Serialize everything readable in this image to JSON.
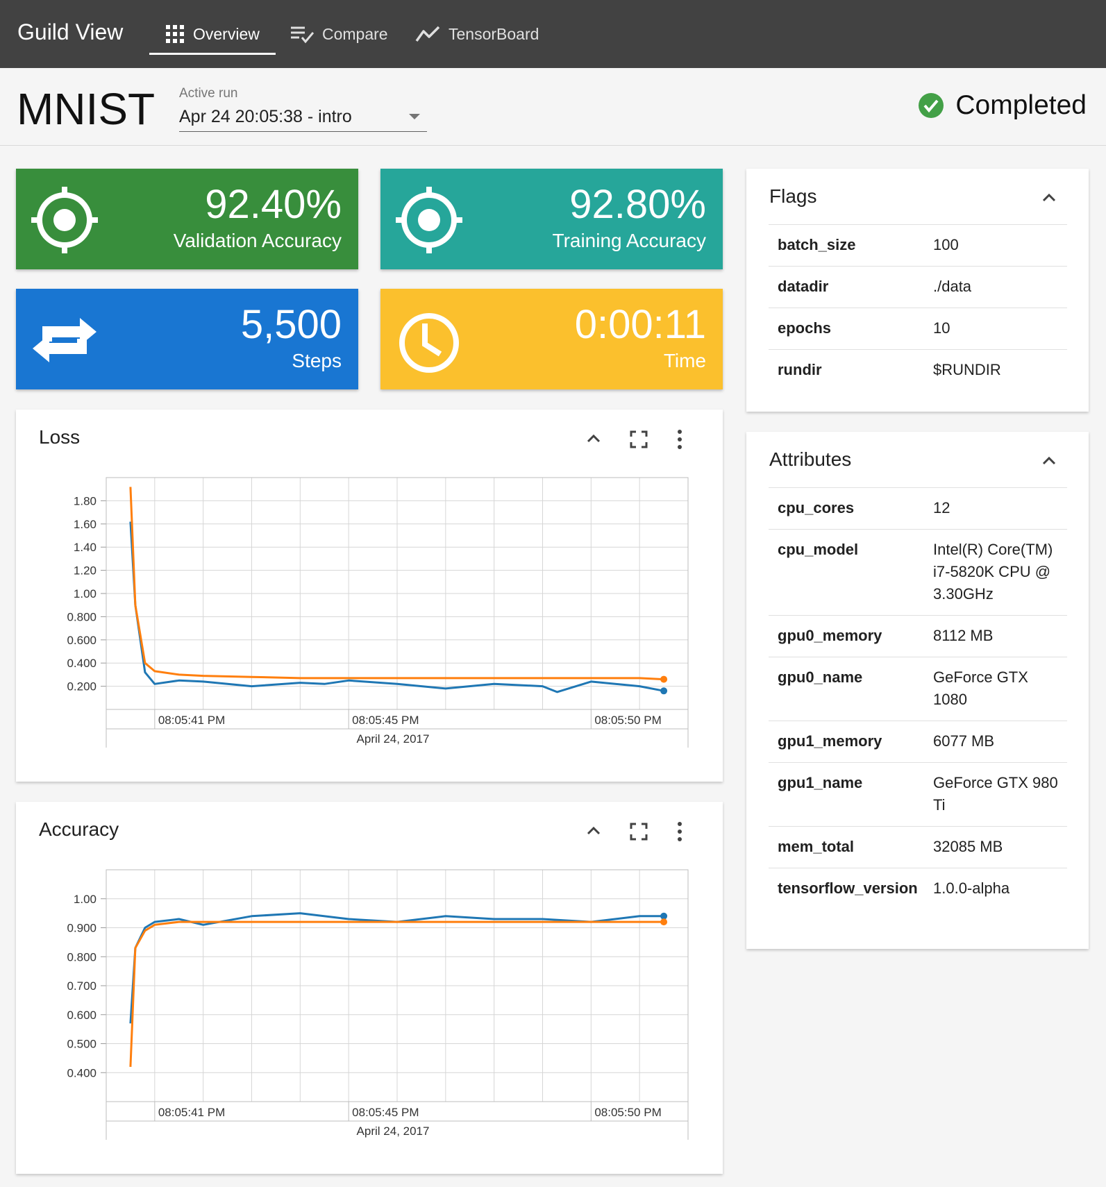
{
  "nav": {
    "brand": "Guild View",
    "tabs": [
      {
        "label": "Overview",
        "icon": "grid-icon",
        "active": true
      },
      {
        "label": "Compare",
        "icon": "compare-list-icon"
      },
      {
        "label": "TensorBoard",
        "icon": "line-chart-icon"
      }
    ]
  },
  "header": {
    "project": "MNIST",
    "run_label": "Active run",
    "run_value": "Apr 24 20:05:38 - intro",
    "status": "Completed",
    "status_color": "#43a047"
  },
  "stats": [
    {
      "value": "92.40%",
      "label": "Validation Accuracy",
      "color": "#388e3c",
      "icon": "target-icon"
    },
    {
      "value": "92.80%",
      "label": "Training Accuracy",
      "color": "#26a69a",
      "icon": "target-icon"
    },
    {
      "value": "5,500",
      "label": "Steps",
      "color": "#1976d2",
      "icon": "repeat-icon"
    },
    {
      "value": "0:00:11",
      "label": "Time",
      "color": "#fbc02d",
      "icon": "clock-icon"
    }
  ],
  "flags": {
    "title": "Flags",
    "rows": [
      {
        "key": "batch_size",
        "value": "100"
      },
      {
        "key": "datadir",
        "value": "./data"
      },
      {
        "key": "epochs",
        "value": "10"
      },
      {
        "key": "rundir",
        "value": "$RUNDIR"
      }
    ]
  },
  "attributes": {
    "title": "Attributes",
    "rows": [
      {
        "key": "cpu_cores",
        "value": "12"
      },
      {
        "key": "cpu_model",
        "value": "Intel(R) Core(TM) i7-5820K CPU @ 3.30GHz"
      },
      {
        "key": "gpu0_memory",
        "value": "8112 MB"
      },
      {
        "key": "gpu0_name",
        "value": "GeForce GTX 1080"
      },
      {
        "key": "gpu1_memory",
        "value": "6077 MB"
      },
      {
        "key": "gpu1_name",
        "value": "GeForce GTX 980 Ti"
      },
      {
        "key": "mem_total",
        "value": "32085 MB"
      },
      {
        "key": "tensorflow_version",
        "value": "1.0.0-alpha"
      }
    ]
  },
  "chart_data": [
    {
      "type": "line",
      "title": "Loss",
      "xlabel": "April 24, 2017",
      "x_ticks": [
        {
          "t": 41,
          "label": "08:05:41 PM"
        },
        {
          "t": 45,
          "label": "08:05:45 PM"
        },
        {
          "t": 50,
          "label": "08:05:50 PM"
        }
      ],
      "y_ticks": [
        "0.200",
        "0.400",
        "0.600",
        "0.800",
        "1.00",
        "1.20",
        "1.40",
        "1.60",
        "1.80"
      ],
      "xlim": [
        40.0,
        52.0
      ],
      "ylim": [
        0.0,
        2.0
      ],
      "grid": true,
      "series": [
        {
          "color": "#1f77b4",
          "x": [
            40.5,
            40.6,
            40.8,
            41.0,
            41.5,
            42.0,
            43.0,
            44.0,
            44.5,
            45.0,
            46.0,
            47.0,
            48.0,
            49.0,
            49.3,
            50.0,
            51.0,
            51.5
          ],
          "y": [
            1.62,
            0.9,
            0.32,
            0.22,
            0.25,
            0.24,
            0.2,
            0.23,
            0.22,
            0.25,
            0.22,
            0.18,
            0.22,
            0.2,
            0.15,
            0.24,
            0.2,
            0.16
          ]
        },
        {
          "color": "#ff7f0e",
          "x": [
            40.5,
            40.6,
            40.8,
            41.0,
            41.5,
            42.0,
            43.0,
            44.0,
            45.0,
            46.0,
            47.0,
            48.0,
            49.0,
            50.0,
            51.0,
            51.5
          ],
          "y": [
            1.92,
            0.9,
            0.4,
            0.33,
            0.3,
            0.29,
            0.28,
            0.27,
            0.27,
            0.27,
            0.27,
            0.27,
            0.27,
            0.27,
            0.27,
            0.26
          ]
        }
      ]
    },
    {
      "type": "line",
      "title": "Accuracy",
      "xlabel": "April 24, 2017",
      "x_ticks": [
        {
          "t": 41,
          "label": "08:05:41 PM"
        },
        {
          "t": 45,
          "label": "08:05:45 PM"
        },
        {
          "t": 50,
          "label": "08:05:50 PM"
        }
      ],
      "y_ticks": [
        "0.400",
        "0.500",
        "0.600",
        "0.700",
        "0.800",
        "0.900",
        "1.00"
      ],
      "xlim": [
        40.0,
        52.0
      ],
      "ylim": [
        0.3,
        1.1
      ],
      "grid": true,
      "series": [
        {
          "color": "#1f77b4",
          "x": [
            40.5,
            40.6,
            40.8,
            41.0,
            41.5,
            42.0,
            43.0,
            44.0,
            45.0,
            46.0,
            47.0,
            48.0,
            49.0,
            50.0,
            51.0,
            51.5
          ],
          "y": [
            0.57,
            0.83,
            0.9,
            0.92,
            0.93,
            0.91,
            0.94,
            0.95,
            0.93,
            0.92,
            0.94,
            0.93,
            0.93,
            0.92,
            0.94,
            0.94
          ],
          "end_value": 0.94
        },
        {
          "color": "#ff7f0e",
          "x": [
            40.5,
            40.6,
            40.8,
            41.0,
            41.5,
            42.0,
            43.0,
            44.0,
            45.0,
            46.0,
            47.0,
            48.0,
            49.0,
            50.0,
            51.0,
            51.5
          ],
          "y": [
            0.42,
            0.83,
            0.89,
            0.91,
            0.92,
            0.92,
            0.92,
            0.92,
            0.92,
            0.92,
            0.92,
            0.92,
            0.92,
            0.92,
            0.92,
            0.92
          ]
        }
      ]
    }
  ]
}
